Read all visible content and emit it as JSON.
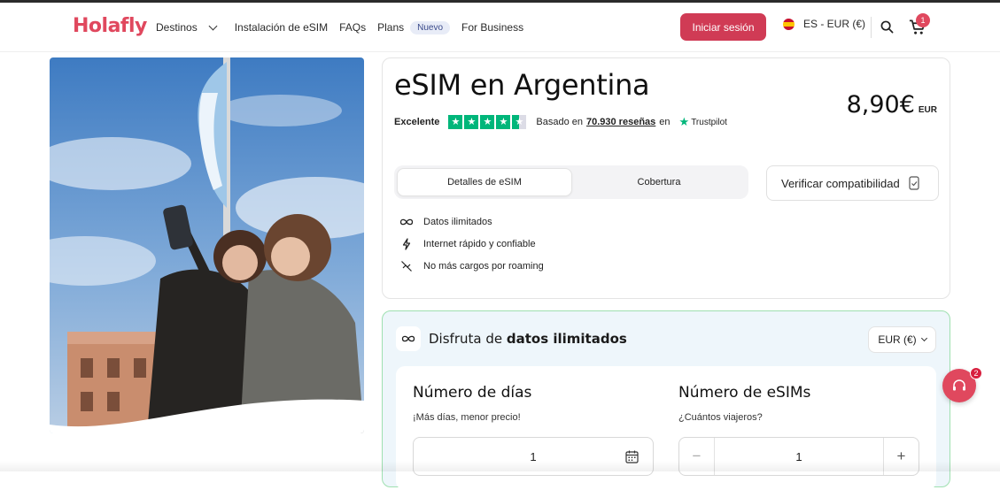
{
  "brand": {
    "logo": "Holafly",
    "accent": "#d03b55"
  },
  "nav": {
    "items": [
      {
        "label": "Destinos",
        "has_dropdown": true
      },
      {
        "label": "Instalación de eSIM"
      },
      {
        "label": "FAQs"
      },
      {
        "label": "Plans",
        "badge": "Nuevo"
      },
      {
        "label": "For Business"
      }
    ]
  },
  "header": {
    "login_label": "Iniciar sesión",
    "language_label": "ES - EUR (€)",
    "cart_count": "1",
    "icons": [
      "search-icon",
      "cart-icon",
      "spain-flag-icon"
    ]
  },
  "product": {
    "title": "eSIM en Argentina",
    "price": "8,90€",
    "currency": "EUR",
    "rating": {
      "label": "Excelente",
      "stars": 4.5,
      "based_on": "Basado en",
      "reviews": "70.930 reseñas",
      "on": "en",
      "provider": "Trustpilot"
    },
    "tabs": [
      {
        "label": "Detalles de eSIM",
        "active": true
      },
      {
        "label": "Cobertura",
        "active": false
      }
    ],
    "verify_label": "Verificar compatibilidad",
    "features": [
      {
        "icon": "infinity-icon",
        "label": "Datos ilimitados"
      },
      {
        "icon": "lightning-icon",
        "label": "Internet rápido y confiable"
      },
      {
        "icon": "no-roaming-icon",
        "label": "No más cargos por roaming"
      }
    ]
  },
  "plan": {
    "title_prefix": "Disfruta de",
    "title_bold": "datos ilimitados",
    "currency_select": "EUR (€)",
    "days": {
      "title": "Número de días",
      "subtitle": "¡Más días, menor precio!",
      "value": "1"
    },
    "esims": {
      "title": "Número de eSIMs",
      "subtitle": "¿Cuántos viajeros?",
      "value": "1",
      "minus": "−",
      "plus": "+"
    }
  },
  "chat": {
    "badge": "2"
  }
}
